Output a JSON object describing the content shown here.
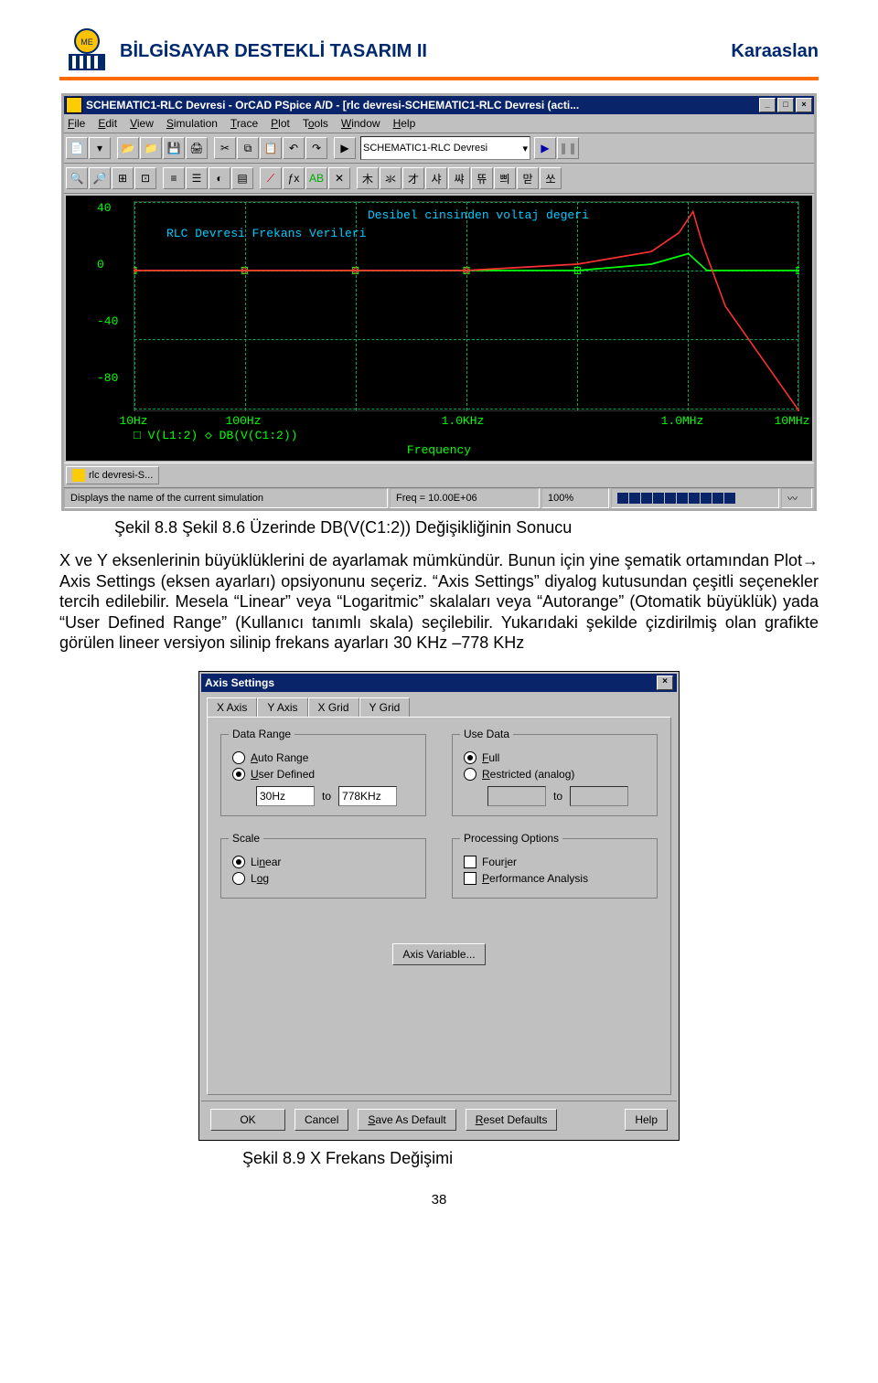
{
  "header": {
    "title": "BİLGİSAYAR DESTEKLİ TASARIM II",
    "author": "Karaaslan"
  },
  "pspice": {
    "title": "SCHEMATIC1-RLC Devresi - OrCAD PSpice A/D  - [rlc devresi-SCHEMATIC1-RLC Devresi (acti...",
    "menus": [
      "File",
      "Edit",
      "View",
      "Simulation",
      "Trace",
      "Plot",
      "Tools",
      "Window",
      "Help"
    ],
    "combo": "SCHEMATIC1-RLC Devresi",
    "yticks": [
      "40",
      "0",
      "-40",
      "-80"
    ],
    "xticks": [
      "10Hz",
      "100Hz",
      "1.0KHz",
      "1.0MHz",
      "10MHz"
    ],
    "note1": "Desibel  cinsinden voltaj  degeri",
    "note2": "RLC  Devresi  Frekans  Verileri",
    "legend": "□ V(L1:2)  ◇ DB(V(C1:2))",
    "xlabel": "Frequency",
    "task": "rlc devresi-S...",
    "status_left": "Displays the name of the current simulation",
    "status_freq": "Freq = 10.00E+06",
    "status_pct": "100%"
  },
  "caption1": "Şekil 8.8 Şekil 8.6 Üzerinde DB(V(C1:2)) Değişikliğinin Sonucu",
  "body": "X ve Y eksenlerinin büyüklüklerini de ayarlamak mümkündür. Bunun için yine şematik ortamından Plot→ Axis Settings (eksen ayarları) opsiyonunu seçeriz. “Axis Settings” diyalog kutusundan çeşitli seçenekler tercih edilebilir. Mesela “Linear” veya “Logaritmic” skalaları veya “Autorange” (Otomatik büyüklük) yada “User Defined Range” (Kullanıcı tanımlı skala) seçilebilir. Yukarıdaki şekilde çizdirilmiş olan grafikte görülen lineer versiyon silinip frekans ayarları 30 KHz –778 KHz",
  "dialog": {
    "title": "Axis Settings",
    "tabs": [
      "X Axis",
      "Y Axis",
      "X Grid",
      "Y Grid"
    ],
    "data_range": {
      "title": "Data Range",
      "auto": "Auto Range",
      "user": "User Defined",
      "from": "30Hz",
      "to_lbl": "to",
      "to": "778KHz"
    },
    "use_data": {
      "title": "Use Data",
      "full": "Full",
      "restricted": "Restricted (analog)",
      "to_lbl": "to"
    },
    "scale": {
      "title": "Scale",
      "linear": "Linear",
      "log": "Log"
    },
    "proc": {
      "title": "Processing Options",
      "fourier": "Fourier",
      "perf": "Performance Analysis"
    },
    "axis_var": "Axis Variable...",
    "buttons": {
      "ok": "OK",
      "cancel": "Cancel",
      "save": "Save As Default",
      "reset": "Reset Defaults",
      "help": "Help"
    }
  },
  "caption2": "Şekil 8.9  X Frekans Değişimi",
  "page_number": "38",
  "chart_data": {
    "type": "line",
    "title": "RLC Devresi Frekans Verileri",
    "xlabel": "Frequency",
    "ylabel": "",
    "x_scale": "log",
    "xlim": [
      "10Hz",
      "10MHz"
    ],
    "ylim": [
      -80,
      40
    ],
    "x": [
      "10Hz",
      "100Hz",
      "1.0KHz",
      "10KHz",
      "100KHz",
      "1.0MHz",
      "10MHz"
    ],
    "series": [
      {
        "name": "V(L1:2)",
        "color": "#00ff00",
        "values": [
          0,
          0,
          0,
          0,
          0,
          2,
          0
        ]
      },
      {
        "name": "DB(V(C1:2))",
        "color": "#ff3030",
        "values": [
          0,
          0,
          0,
          0,
          5,
          30,
          -80
        ]
      }
    ],
    "annotations": [
      "Desibel cinsinden voltaj degeri"
    ]
  }
}
